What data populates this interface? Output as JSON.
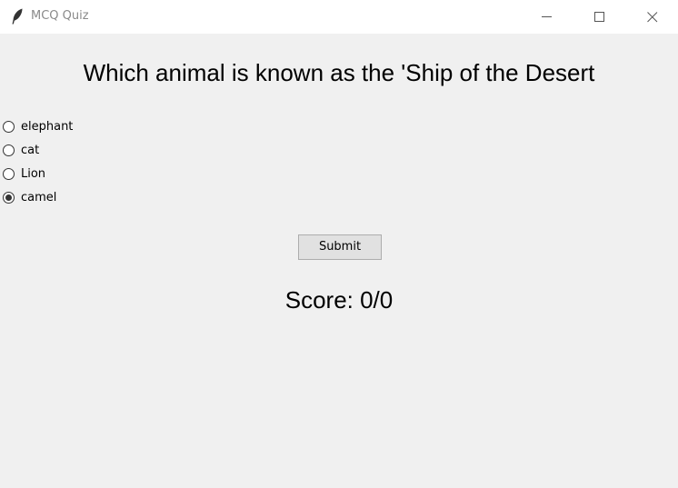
{
  "window": {
    "title": "MCQ Quiz",
    "icon": "feather-icon",
    "controls": [
      "minimize-icon",
      "maximize-icon",
      "close-icon"
    ]
  },
  "quiz": {
    "question": "Which animal is known as the 'Ship of the Desert",
    "options": [
      {
        "label": "elephant",
        "selected": false
      },
      {
        "label": "cat",
        "selected": false
      },
      {
        "label": "Lion",
        "selected": false
      },
      {
        "label": "camel",
        "selected": true
      }
    ],
    "submit_label": "Submit",
    "score_text": "Score: 0/0"
  }
}
